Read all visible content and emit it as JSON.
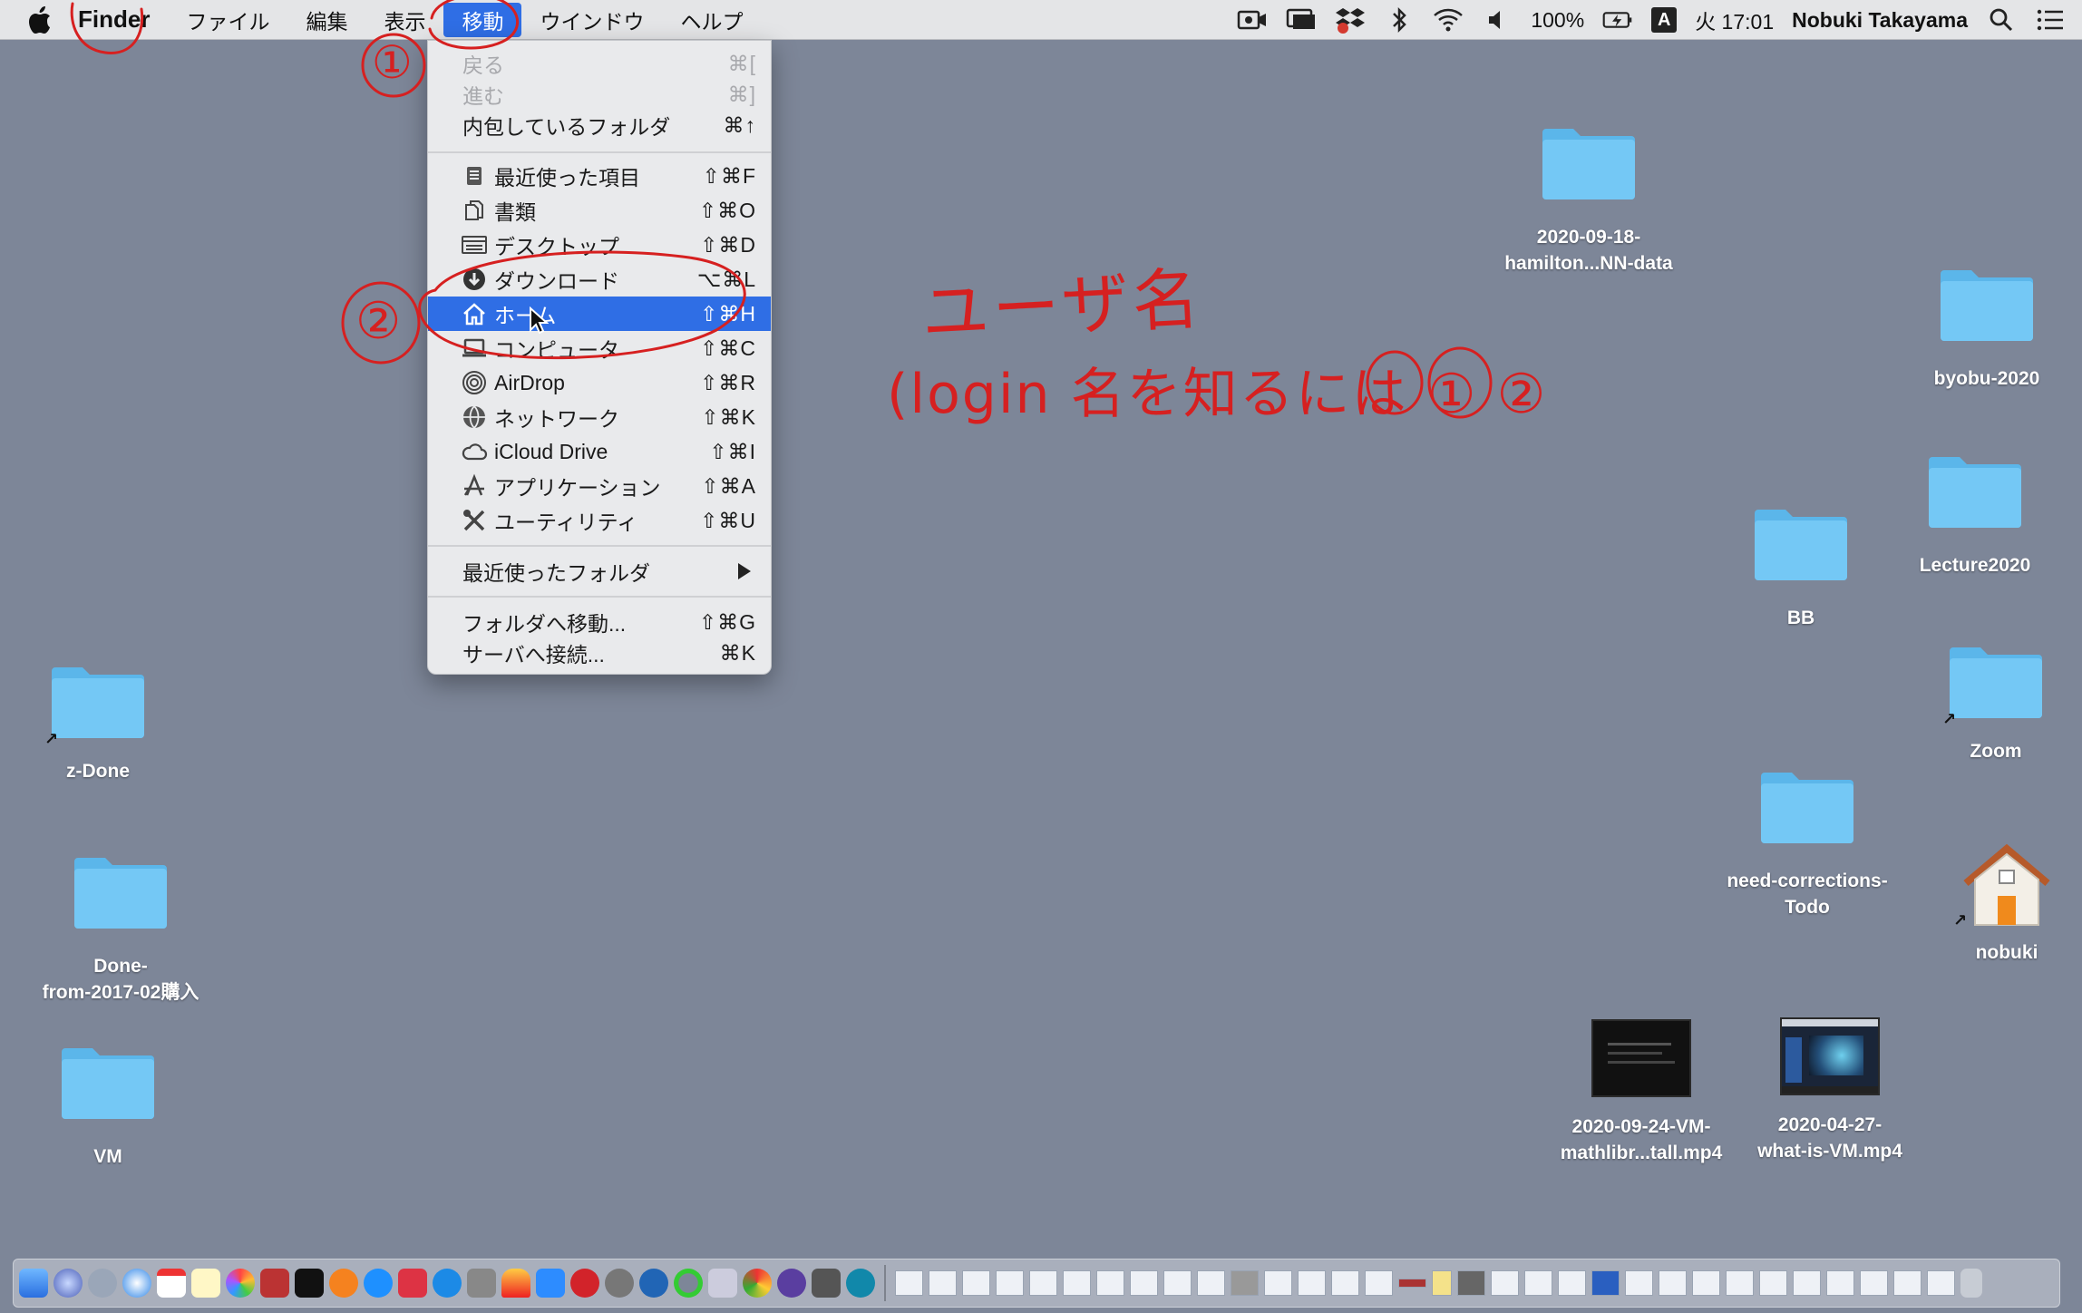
{
  "menubar": {
    "app_name": "Finder",
    "menus": [
      "ファイル",
      "編集",
      "表示",
      "移動",
      "ウインドウ",
      "ヘルプ"
    ],
    "active_menu": "移動",
    "status": {
      "battery": "100%",
      "input_source": "A",
      "clock": "火 17:01",
      "user": "Nobuki Takayama"
    }
  },
  "go_menu": {
    "items": [
      {
        "label": "戻る",
        "shortcut": "⌘[",
        "disabled": true
      },
      {
        "label": "進む",
        "shortcut": "⌘]",
        "disabled": true
      },
      {
        "label": "内包しているフォルダ",
        "shortcut": "⌘↑"
      },
      {
        "label": "最近使った項目",
        "shortcut": "⇧⌘F",
        "icon": "recents-icon"
      },
      {
        "label": "書類",
        "shortcut": "⇧⌘O",
        "icon": "documents-icon"
      },
      {
        "label": "デスクトップ",
        "shortcut": "⇧⌘D",
        "icon": "desktop-icon"
      },
      {
        "label": "ダウンロード",
        "shortcut": "⌥⌘L",
        "icon": "downloads-icon"
      },
      {
        "label": "ホーム",
        "shortcut": "⇧⌘H",
        "icon": "home-icon",
        "selected": true
      },
      {
        "label": "コンピュータ",
        "shortcut": "⇧⌘C",
        "icon": "computer-icon"
      },
      {
        "label": "AirDrop",
        "shortcut": "⇧⌘R",
        "icon": "airdrop-icon"
      },
      {
        "label": "ネットワーク",
        "shortcut": "⇧⌘K",
        "icon": "network-icon"
      },
      {
        "label": "iCloud Drive",
        "shortcut": "⇧⌘I",
        "icon": "icloud-icon"
      },
      {
        "label": "アプリケーション",
        "shortcut": "⇧⌘A",
        "icon": "applications-icon"
      },
      {
        "label": "ユーティリティ",
        "shortcut": "⇧⌘U",
        "icon": "utilities-icon"
      },
      {
        "label": "最近使ったフォルダ",
        "submenu": true
      },
      {
        "label": "フォルダへ移動...",
        "shortcut": "⇧⌘G"
      },
      {
        "label": "サーバへ接続...",
        "shortcut": "⌘K"
      }
    ]
  },
  "annotations": {
    "circle_1": "①",
    "circle_2": "②",
    "line1": "ユーザ名",
    "line2": "(login 名を知るには ① ②"
  },
  "desktop": {
    "icons": [
      {
        "name": "2020-09-18-\nhamilton...NN-data",
        "kind": "folder"
      },
      {
        "name": "byobu-2020",
        "kind": "folder"
      },
      {
        "name": "Lecture2020",
        "kind": "folder"
      },
      {
        "name": "BB",
        "kind": "folder"
      },
      {
        "name": "Zoom",
        "kind": "folder-alias"
      },
      {
        "name": "need-corrections-\nTodo",
        "kind": "folder"
      },
      {
        "name": "nobuki",
        "kind": "home-alias"
      },
      {
        "name": "2020-09-24-VM-\nmathlibr...tall.mp4",
        "kind": "video"
      },
      {
        "name": "2020-04-27-\nwhat-is-VM.mp4",
        "kind": "video"
      },
      {
        "name": "z-Done",
        "kind": "folder-alias"
      },
      {
        "name": "Done-\nfrom-2017-02購入",
        "kind": "folder"
      },
      {
        "name": "VM",
        "kind": "folder"
      }
    ]
  },
  "colors": {
    "desktop": "#7d8698",
    "accent": "#2f6ee5",
    "folder": "#67c3f3",
    "annotation": "#d62020"
  }
}
